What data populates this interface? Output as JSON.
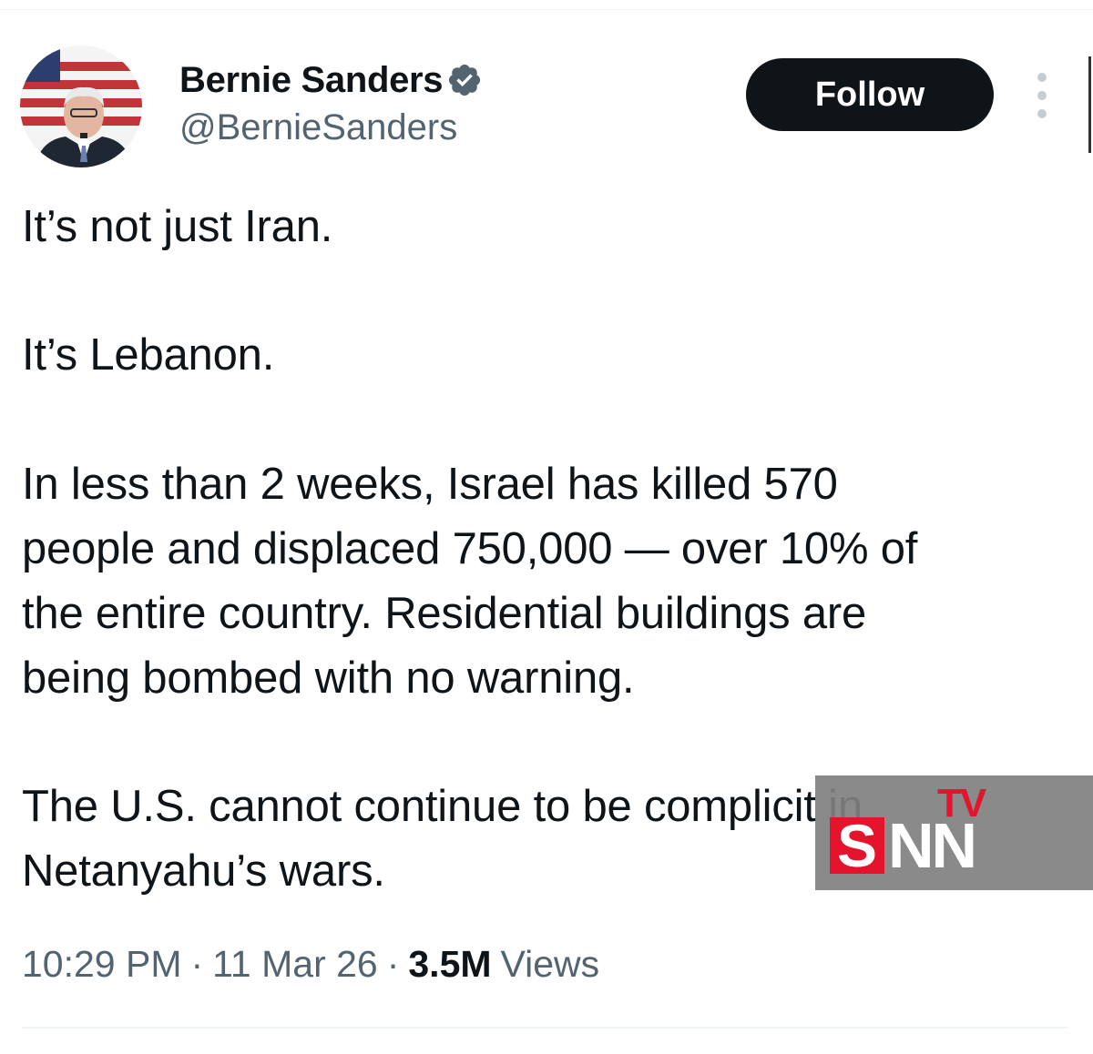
{
  "author": {
    "display_name": "Bernie Sanders",
    "handle": "@BernieSanders",
    "verified_icon": "verified-badge-icon",
    "avatar": "profile-photo"
  },
  "actions": {
    "follow_label": "Follow",
    "more_icon": "more-options-icon"
  },
  "tweet": {
    "paragraphs": [
      "It’s not just Iran.",
      "It’s Lebanon.",
      "In less than 2 weeks, Israel has killed 570\npeople and displaced 750,000 — over 10% of\nthe entire country. Residential buildings are\nbeing bombed with no warning.",
      "The U.S. cannot continue to be complicit in\nNetanyahu’s wars."
    ]
  },
  "meta": {
    "time": "10:29 PM",
    "separator": "·",
    "date": "11 Mar 26",
    "views_count": "3.5M",
    "views_label": "Views"
  },
  "watermark": {
    "tv": "TV",
    "s": "S",
    "nn": "NN"
  },
  "colors": {
    "text_primary": "#0f1419",
    "text_secondary": "#536471",
    "verified_blue": "#1d9bf0",
    "watermark_red": "#e3142b"
  }
}
